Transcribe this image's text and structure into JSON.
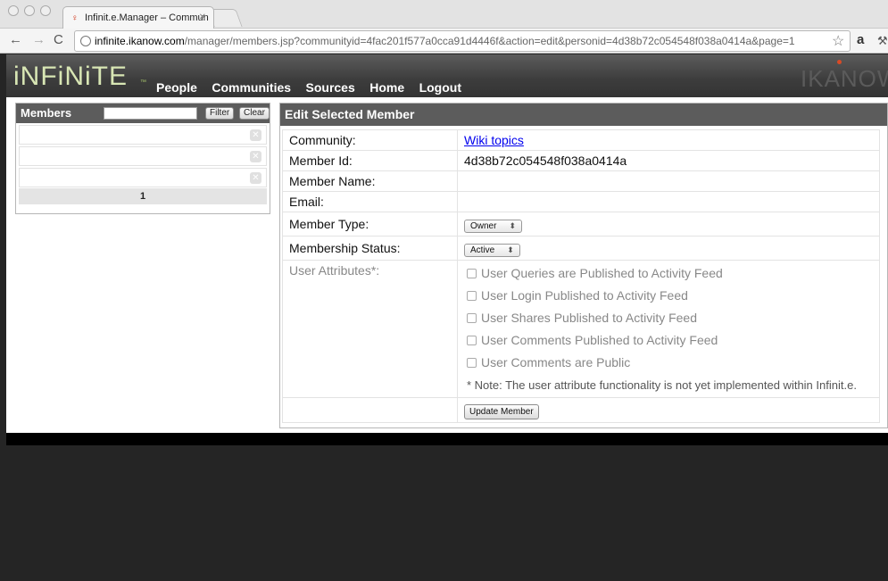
{
  "browser": {
    "tab_title": "Infinit.e.Manager – Commun",
    "url_host": "infinite.ikanow.com",
    "url_rest": "/manager/members.jsp?communityid=4fac201f577a0cca91d4446f&action=edit&personid=4d38b72c054548f038a0414a&page=1"
  },
  "header": {
    "logo": "iNFiNiTE",
    "nav": [
      "People",
      "Communities",
      "Sources",
      "Home",
      "Logout"
    ],
    "brand_right": "IKANOW"
  },
  "members": {
    "title": "Members",
    "filter_value": "",
    "filter_label": "Filter",
    "clear_label": "Clear",
    "rows": [
      "",
      "",
      ""
    ],
    "page": "1"
  },
  "edit": {
    "title": "Edit Selected Member",
    "fields": {
      "community_label": "Community:",
      "community_value": "Wiki topics",
      "member_id_label": "Member Id:",
      "member_id_value": "4d38b72c054548f038a0414a",
      "member_name_label": "Member Name:",
      "member_name_value": "",
      "email_label": "Email:",
      "email_value": "",
      "member_type_label": "Member Type:",
      "member_type_value": "Owner",
      "status_label": "Membership Status:",
      "status_value": "Active",
      "attributes_label": "User Attributes*:"
    },
    "attributes": [
      "User Queries are Published to Activity Feed",
      "User Login Published to Activity Feed",
      "User Shares Published to Activity Feed",
      "User Comments Published to Activity Feed",
      "User Comments are Public"
    ],
    "note": "* Note: The user attribute functionality is not yet implemented within Infinit.e.",
    "update_label": "Update Member"
  }
}
